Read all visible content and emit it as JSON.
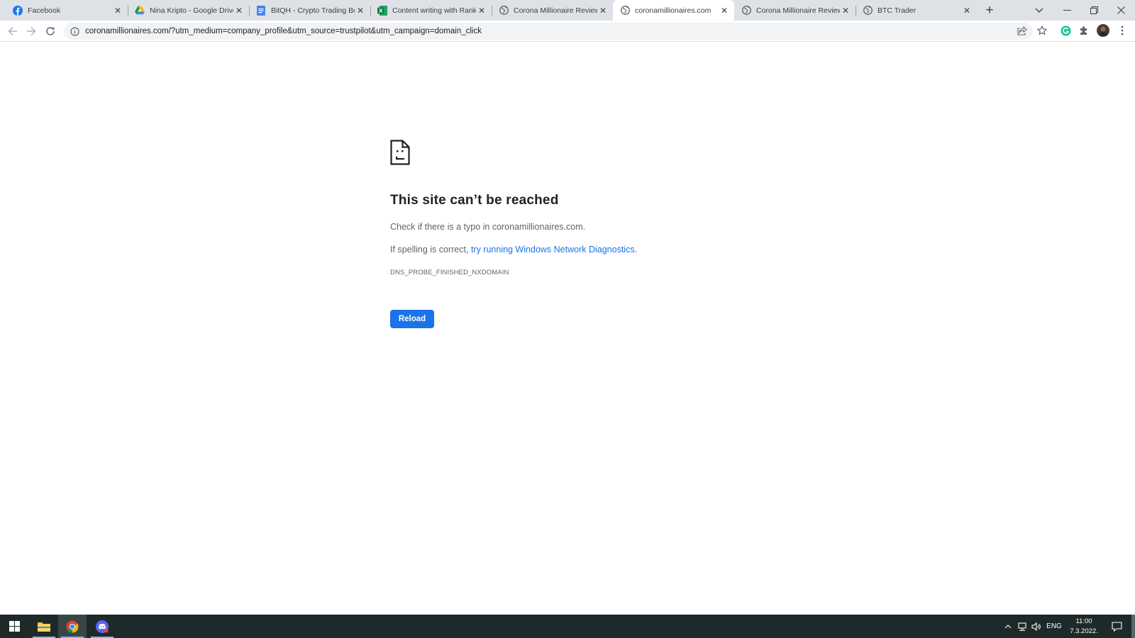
{
  "browser": {
    "tabs": [
      {
        "title": "Facebook",
        "icon": "facebook-icon",
        "active": false
      },
      {
        "title": "Nina Kripto - Google Drive",
        "icon": "google-drive-icon",
        "active": false
      },
      {
        "title": "BitQH - Crypto Trading Bot",
        "icon": "google-docs-icon",
        "active": false
      },
      {
        "title": "Content writing with Rank",
        "icon": "excel-icon",
        "active": false
      },
      {
        "title": "Corona Millionaire Review",
        "icon": "globe-icon",
        "active": false
      },
      {
        "title": "coronamillionaires.com",
        "icon": "globe-icon",
        "active": true
      },
      {
        "title": "Corona Millionaire Review",
        "icon": "globe-icon",
        "active": false
      },
      {
        "title": "BTC Trader",
        "icon": "globe-icon",
        "active": false
      }
    ],
    "new_tab_glyph": "+",
    "url": "coronamillionaires.com/?utm_medium=company_profile&utm_source=trustpilot&utm_campaign=domain_click"
  },
  "error_page": {
    "heading": "This site can’t be reached",
    "line1": "Check if there is a typo in coronamillionaires.com.",
    "line2_prefix": "If spelling is correct, ",
    "line2_link": "try running Windows Network Diagnostics",
    "line2_suffix": ".",
    "error_code": "DNS_PROBE_FINISHED_NXDOMAIN",
    "reload_label": "Reload",
    "accent_color": "#1a73e8"
  },
  "taskbar": {
    "apps": [
      "windows-start-icon",
      "file-explorer-icon",
      "chrome-icon",
      "discord-icon"
    ],
    "language": "ENG",
    "time": "11:00",
    "date": "7.3.2022."
  }
}
